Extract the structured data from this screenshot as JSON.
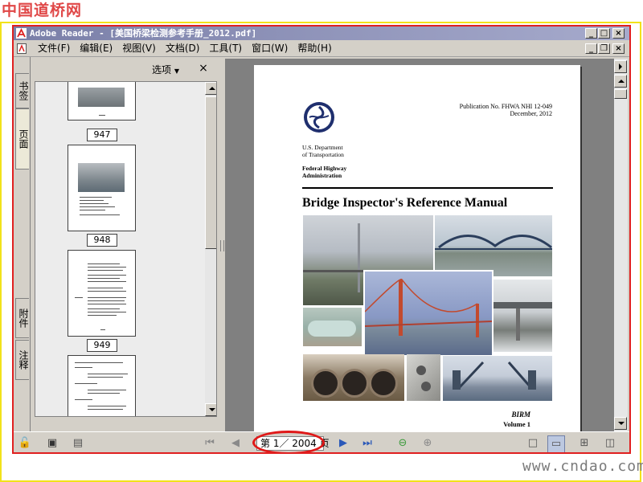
{
  "site_logo": "中国道桥网",
  "watermark": "www.cndao.com",
  "window": {
    "title": "Adobe Reader - [美国桥梁检测参考手册_2012.pdf]"
  },
  "menu": [
    "文件(F)",
    "编辑(E)",
    "视图(V)",
    "文档(D)",
    "工具(T)",
    "窗口(W)",
    "帮助(H)"
  ],
  "left_tabs": {
    "bookmarks": "书签",
    "pages": "页面",
    "attachments": "附件",
    "comments": "注释"
  },
  "nav_panel": {
    "options_label": "选项",
    "close_label": "×",
    "thumbnails": [
      {
        "page_label": "947"
      },
      {
        "page_label": "948"
      },
      {
        "page_label": "949"
      }
    ]
  },
  "document": {
    "publication_no": "Publication No. FHWA NHI 12-049",
    "date": "December, 2012",
    "dept_line1": "U.S. Department",
    "dept_line2": "of Transportation",
    "agency_line1": "Federal Highway",
    "agency_line2": "Administration",
    "title": "Bridge Inspector's Reference Manual",
    "series": "BIRM",
    "volume": "Volume 1"
  },
  "bottom": {
    "page_display": "第 1／ 2004 页"
  },
  "colors": {
    "frame_yellow": "#f2e21a",
    "frame_red": "#e02020",
    "titlebar": "#7a7fa8",
    "logo_red": "#e04848"
  }
}
